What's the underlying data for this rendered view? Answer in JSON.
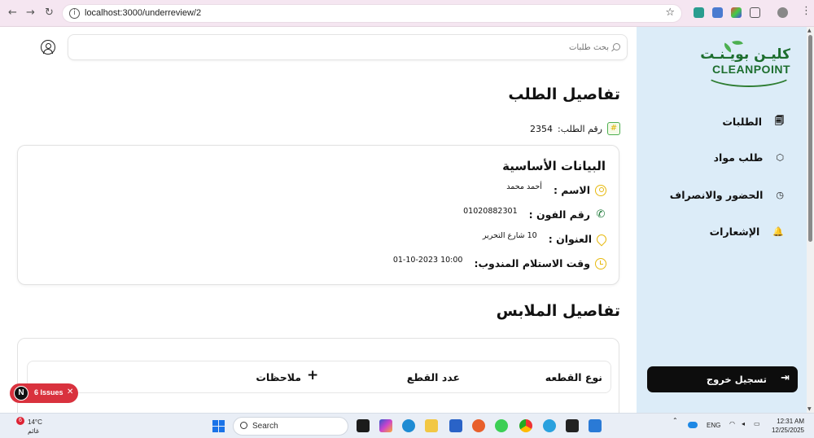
{
  "browser": {
    "url": "localhost:3000/underreview/2",
    "back": "←",
    "forward": "→",
    "reload": "↻"
  },
  "search": {
    "placeholder": "بحث طلبات"
  },
  "page": {
    "title": "تفاصيل الطلب",
    "order_label": "رقم الطلب:",
    "order_value": "2354",
    "hash_glyph": "#"
  },
  "basic": {
    "title": "البيانات الأساسية",
    "name_label": "الاسم :",
    "name_value": "أحمد محمد",
    "phone_label": "رقم الفون :",
    "phone_value": "01020882301",
    "address_label": "العنوان :",
    "address_value": "10 شارع التحرير",
    "pickup_label": "وقت الاستلام المندوب:",
    "pickup_value": "01-10-2023 10:00"
  },
  "clothes": {
    "title": "تفاصيل الملابس",
    "col_type": "نوع القطعه",
    "col_count": "عدد القطع",
    "col_notes": "ملاحظات",
    "add_glyph": "+"
  },
  "sidebar": {
    "logo_ar": "كليـن بويـنـت",
    "logo_en": "CLEANPOINT",
    "items": [
      {
        "label": "الطلبات",
        "icon": "🗐"
      },
      {
        "label": "طلب مواد",
        "icon": "⬡"
      },
      {
        "label": "الحضور والانصراف",
        "icon": "◷"
      },
      {
        "label": "الإشعارات",
        "icon": "🔔"
      }
    ],
    "logout_label": "تسجيل خروج",
    "logout_icon": "⇥"
  },
  "issues": {
    "letter": "N",
    "label": "6 Issues",
    "close": "✕"
  },
  "taskbar": {
    "temp": "14°C",
    "weather": "غائم",
    "weather_badge": "6",
    "search": "Search",
    "lang": "ENG",
    "time": "12:31 AM",
    "date": "12/25/2025"
  },
  "colors": {
    "accent": "#e7b90e",
    "brand": "#1d6e2e",
    "sidebar_bg": "#dcecf8"
  }
}
